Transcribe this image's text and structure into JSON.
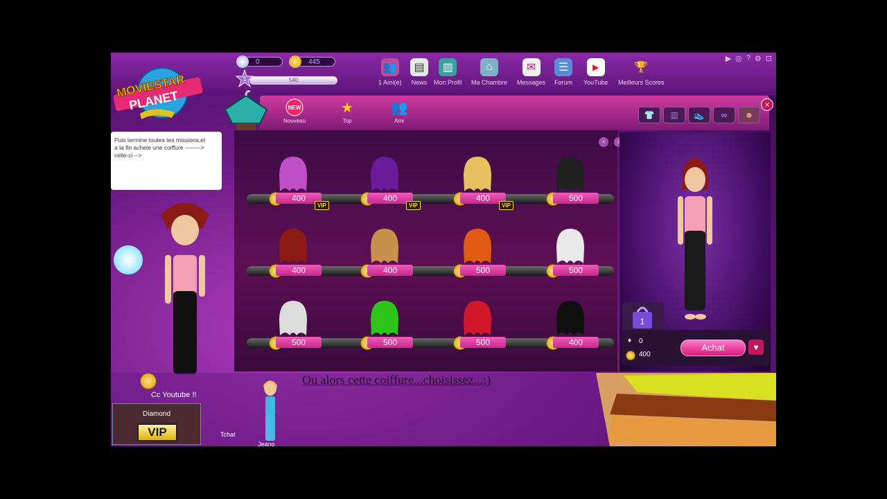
{
  "logo": {
    "line1": "MOVIESTAR",
    "line2": "PLANET"
  },
  "stats": {
    "diamonds": "0",
    "coins": "445",
    "level": "1",
    "xp": "540"
  },
  "nav": [
    {
      "icon": "friends-icon",
      "label": "1 Ami(e)"
    },
    {
      "icon": "news-icon",
      "label": "News"
    },
    {
      "icon": "profile-icon",
      "label": "Mon Profil"
    },
    {
      "icon": "room-icon",
      "label": "Ma Chambre"
    },
    {
      "icon": "messages-icon",
      "label": "Messages"
    },
    {
      "icon": "forum-icon",
      "label": "Forum"
    },
    {
      "icon": "youtube-icon",
      "label": "YouTube"
    },
    {
      "icon": "trophy-icon",
      "label": "Meilleurs Scores"
    }
  ],
  "shop": {
    "tabs": [
      {
        "icon": "new-badge-icon",
        "label": "Nouveau",
        "badge": "NEW"
      },
      {
        "icon": "star-icon",
        "label": "Top"
      },
      {
        "icon": "friends-icon",
        "label": "Ami"
      }
    ],
    "categories": [
      "shirt-icon",
      "pants-icon",
      "shoes-icon",
      "accessory-icon",
      "hair-icon"
    ],
    "close": "×",
    "prev": "‹",
    "next": "›",
    "items": [
      {
        "price": "400",
        "vip": "VIP",
        "color": "#c050c8"
      },
      {
        "price": "400",
        "vip": "VIP",
        "color": "#6a1a9a"
      },
      {
        "price": "400",
        "vip": "VIP",
        "color": "#e8c060"
      },
      {
        "price": "500",
        "vip": "",
        "color": "#202020"
      },
      {
        "price": "400",
        "vip": "",
        "color": "#8b1a14"
      },
      {
        "price": "400",
        "vip": "",
        "color": "#c8904a"
      },
      {
        "price": "500",
        "vip": "",
        "color": "#e25a10"
      },
      {
        "price": "500",
        "vip": "",
        "color": "#e8e8e8"
      },
      {
        "price": "500",
        "vip": "",
        "color": "#dcdcdc"
      },
      {
        "price": "500",
        "vip": "",
        "color": "#2ec41a"
      },
      {
        "price": "500",
        "vip": "",
        "color": "#d0182a"
      },
      {
        "price": "400",
        "vip": "",
        "color": "#101010"
      }
    ]
  },
  "cart": {
    "count": "1",
    "diamonds": "0",
    "coins": "400",
    "buy_label": "Achat",
    "heart": "♥"
  },
  "chat": {
    "message": "Puis termine toutes tes missions,et a la fin achete une coiffure --------> celle-ci -->"
  },
  "caption": "Ou alors cette coiffure...choisissez...;)",
  "bottom": {
    "speech": "Cc Youtube !!",
    "vip_name": "Diamond",
    "vip_badge": "VIP",
    "tchat": "Tchat",
    "friend": "Jeano"
  }
}
